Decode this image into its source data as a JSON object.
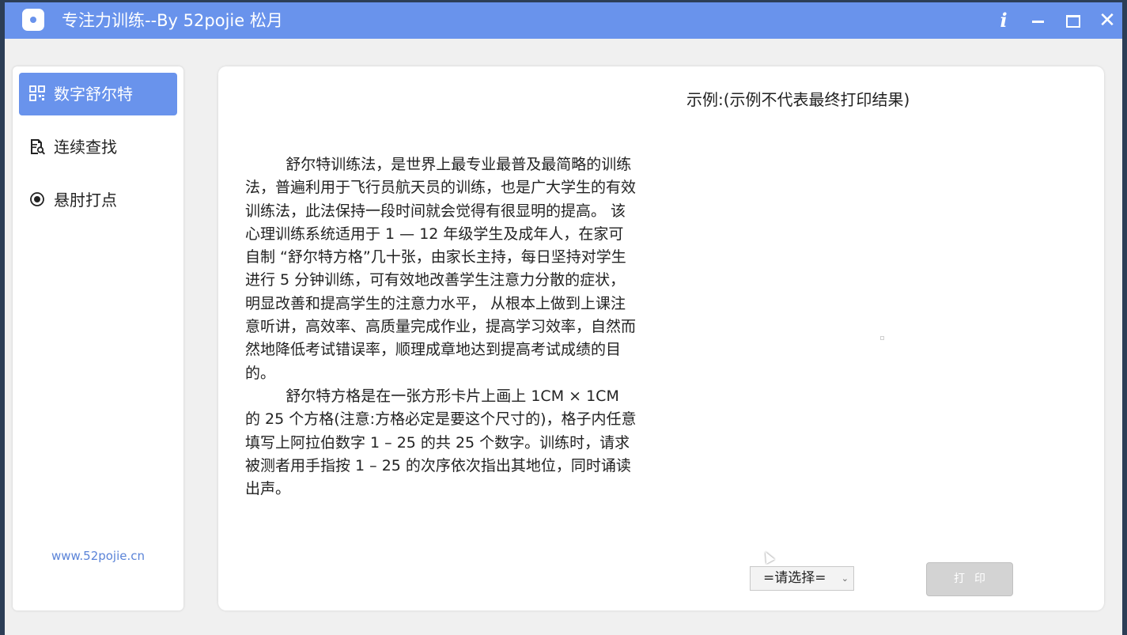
{
  "window": {
    "title": "专注力训练--By 52pojie 松月",
    "info_glyph": "i",
    "close_glyph": "✕"
  },
  "sidebar": {
    "items": [
      {
        "label": "数字舒尔特",
        "icon": "grid-icon",
        "active": true
      },
      {
        "label": "连续查找",
        "icon": "document-search-icon",
        "active": false
      },
      {
        "label": "悬肘打点",
        "icon": "target-dot-icon",
        "active": false
      }
    ],
    "site_link": "www.52pojie.cn"
  },
  "main": {
    "example_title": "示例:(示例不代表最终打印结果)",
    "paragraphs": [
      "舒尔特训练法，是世界上最专业最普及最简略的训练法，普遍利用于飞行员航天员的训练，也是广大学生的有效训练法，此法保持一段时间就会觉得有很显明的提高。 该心理训练系统适用于 1 — 12 年级学生及成年人，在家可自制 “舒尔特方格”几十张，由家长主持，每日坚持对学生进行 5 分钟训练，可有效地改善学生注意力分散的症状，明显改善和提高学生的注意力水平， 从根本上做到上课注意听讲，高效率、高质量完成作业，提高学习效率，自然而然地降低考试错误率，顺理成章地达到提高考试成绩的目的。",
      "舒尔特方格是在一张方形卡片上画上 1CM × 1CM 的 25 个方格(注意:方格必定是要这个尺寸的)，格子内任意填写上阿拉伯数字 1 – 25 的共 25 个数字。训练时，请求被测者用手指按 1 – 25 的次序依次指出其地位，同时诵读出声。"
    ],
    "select": {
      "value": "=请选择=",
      "arrow": "⌄"
    },
    "print_label": "打印"
  },
  "colors": {
    "accent": "#6993ec",
    "link": "#5b84d8",
    "disabled_button": "#d3d3d3"
  }
}
